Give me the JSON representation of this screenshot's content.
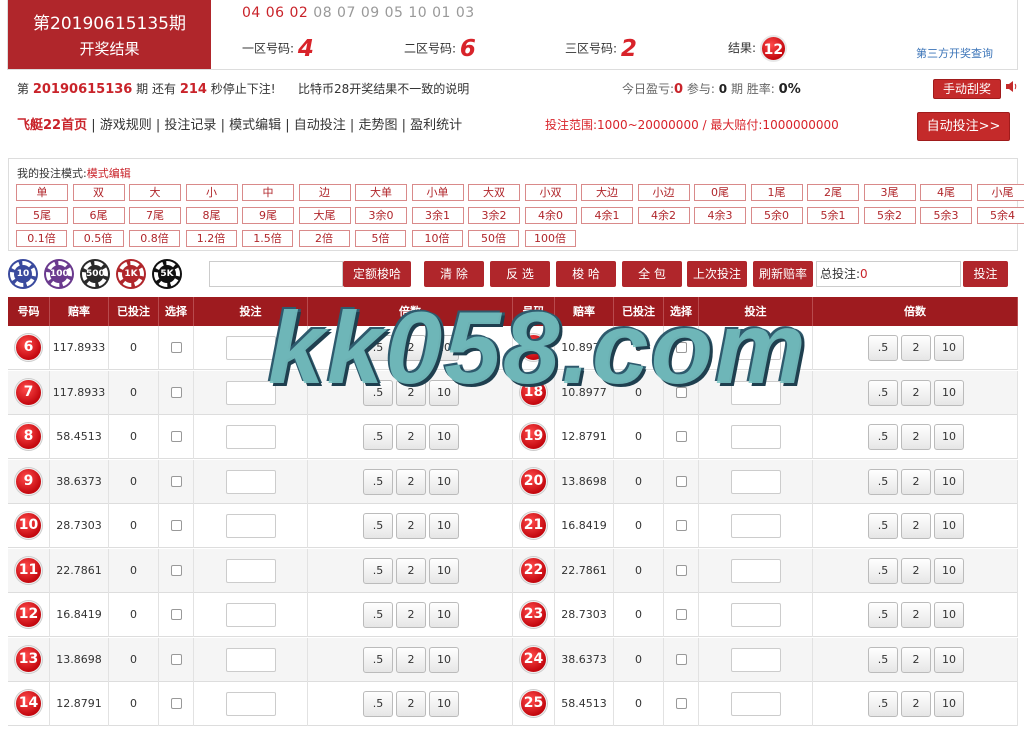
{
  "result": {
    "period_label": "第20190615135期",
    "title": "开奖结果",
    "sequence_red": "04 06 02",
    "sequence_gray": "08 07 09 05 10 01 03",
    "zone1_label": "一区号码:",
    "zone1_value": "4",
    "zone2_label": "二区号码:",
    "zone2_value": "6",
    "zone3_label": "三区号码:",
    "zone3_value": "2",
    "result_label": "结果:",
    "result_value": "12",
    "third_party_link": "第三方开奖查询"
  },
  "status": {
    "prefix": "第",
    "next_period": "20190615136",
    "mid": "期 还有",
    "seconds": "214",
    "suffix": "秒停止下注!",
    "notice": "比特币28开奖结果不一致的说明",
    "today_label": "今日盈亏:",
    "today_profit": "0",
    "participate_label": "参与:",
    "participate_count": "0",
    "period_unit": "期 胜率:",
    "win_rate": "0%",
    "manual_button": "手动刮奖"
  },
  "nav": {
    "home": "飞艇22首页",
    "items": [
      "游戏规则",
      "投注记录",
      "模式编辑",
      "自动投注",
      "走势图",
      "盈利统计"
    ],
    "range": "投注范围:1000~20000000 / 最大赔付:1000000000",
    "auto_button": "自动投注>>"
  },
  "modes": {
    "title": "我的投注模式:",
    "edit": "模式编辑",
    "row1": [
      "单",
      "双",
      "大",
      "小",
      "中",
      "边",
      "大单",
      "小单",
      "大双",
      "小双",
      "大边",
      "小边",
      "0尾",
      "1尾",
      "2尾",
      "3尾",
      "4尾",
      "小尾"
    ],
    "row2": [
      "5尾",
      "6尾",
      "7尾",
      "8尾",
      "9尾",
      "大尾",
      "3余0",
      "3余1",
      "3余2",
      "4余0",
      "4余1",
      "4余2",
      "4余3",
      "5余0",
      "5余1",
      "5余2",
      "5余3",
      "5余4"
    ],
    "row3": [
      "0.1倍",
      "0.5倍",
      "0.8倍",
      "1.2倍",
      "1.5倍",
      "2倍",
      "5倍",
      "10倍",
      "50倍",
      "100倍"
    ]
  },
  "toolbar": {
    "chips": [
      {
        "label": "10",
        "color": "#3a4a9e"
      },
      {
        "label": "100",
        "color": "#6a3a8e"
      },
      {
        "label": "500",
        "color": "#2a2a2a"
      },
      {
        "label": "1K",
        "color": "#b0262b"
      },
      {
        "label": "5K",
        "color": "#111111"
      }
    ],
    "fixed_amount_button": "定额梭哈",
    "clear": "清 除",
    "invert": "反 选",
    "allin": "梭 哈",
    "all": "全 包",
    "last_bet": "上次投注",
    "refresh_odds": "刷新赔率",
    "total_label": "总投注:",
    "total_value": "0",
    "submit": "投注"
  },
  "table": {
    "headers": [
      "号码",
      "赔率",
      "已投注",
      "选择",
      "投注",
      "倍数"
    ],
    "multipliers": [
      ".5",
      "2",
      "10"
    ],
    "left": [
      {
        "num": "6",
        "odds": "117.8933",
        "bet": "0"
      },
      {
        "num": "7",
        "odds": "117.8933",
        "bet": "0"
      },
      {
        "num": "8",
        "odds": "58.4513",
        "bet": "0"
      },
      {
        "num": "9",
        "odds": "38.6373",
        "bet": "0"
      },
      {
        "num": "10",
        "odds": "28.7303",
        "bet": "0"
      },
      {
        "num": "11",
        "odds": "22.7861",
        "bet": "0"
      },
      {
        "num": "12",
        "odds": "16.8419",
        "bet": "0"
      },
      {
        "num": "13",
        "odds": "13.8698",
        "bet": "0"
      },
      {
        "num": "14",
        "odds": "12.8791",
        "bet": "0"
      }
    ],
    "right": [
      {
        "num": "17",
        "odds": "10.8977",
        "bet": "0"
      },
      {
        "num": "18",
        "odds": "10.8977",
        "bet": "0"
      },
      {
        "num": "19",
        "odds": "12.8791",
        "bet": "0"
      },
      {
        "num": "20",
        "odds": "13.8698",
        "bet": "0"
      },
      {
        "num": "21",
        "odds": "16.8419",
        "bet": "0"
      },
      {
        "num": "22",
        "odds": "22.7861",
        "bet": "0"
      },
      {
        "num": "23",
        "odds": "28.7303",
        "bet": "0"
      },
      {
        "num": "24",
        "odds": "38.6373",
        "bet": "0"
      },
      {
        "num": "25",
        "odds": "58.4513",
        "bet": "0"
      }
    ]
  },
  "watermark": "kk058.com"
}
